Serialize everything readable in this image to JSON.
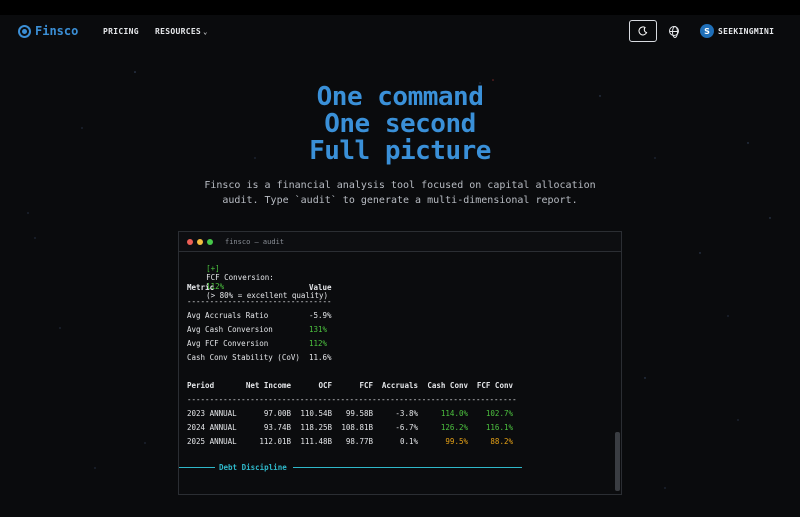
{
  "nav": {
    "brand": "Finsco",
    "links": [
      "PRICING",
      "RESOURCES"
    ],
    "user_initial": "S",
    "username": "SEEKINGMINI"
  },
  "hero": {
    "lines": [
      "One command",
      "One second",
      "Full picture"
    ],
    "subtitle_lines": [
      "Finsco is a financial analysis tool focused on capital allocation",
      "audit. Type `audit` to generate a multi-dimensional report."
    ]
  },
  "terminal": {
    "title": "finsco — audit",
    "fcf_line": {
      "prefix": "[+]",
      "label": "FCF Conversion:",
      "value": "112%",
      "note": "(> 80% = excellent quality)"
    },
    "summary_headers": [
      "Metric",
      "Value"
    ],
    "summary_rule": "--------------------------------",
    "summary_rows": [
      {
        "metric": "Avg Accruals Ratio",
        "value": "-5.9%",
        "tone": "normal"
      },
      {
        "metric": "Avg Cash Conversion",
        "value": "131%",
        "tone": "green"
      },
      {
        "metric": "Avg FCF Conversion",
        "value": "112%",
        "tone": "green"
      },
      {
        "metric": "Cash Conv Stability (CoV)",
        "value": "11.6%",
        "tone": "normal"
      }
    ],
    "period_headers": [
      "Period",
      "Net Income",
      "OCF",
      "FCF",
      "Accruals",
      "Cash Conv",
      "FCF Conv"
    ],
    "period_rule": "-------------------------------------------------------------------------",
    "period_rows": [
      {
        "period": "2023 ANNUAL",
        "net_income": "97.00B",
        "ocf": "110.54B",
        "fcf": "99.58B",
        "accruals": "-3.8%",
        "cash_conv": "114.0%",
        "fcf_conv": "102.7%",
        "cash_tone": "green",
        "fcf_tone": "green"
      },
      {
        "period": "2024 ANNUAL",
        "net_income": "93.74B",
        "ocf": "118.25B",
        "fcf": "108.81B",
        "accruals": "-6.7%",
        "cash_conv": "126.2%",
        "fcf_conv": "116.1%",
        "cash_tone": "green",
        "fcf_tone": "green"
      },
      {
        "period": "2025 ANNUAL",
        "net_income": "112.01B",
        "ocf": "111.48B",
        "fcf": "98.77B",
        "accruals": "0.1%",
        "cash_conv": "99.5%",
        "fcf_conv": "88.2%",
        "cash_tone": "orange",
        "fcf_tone": "orange"
      }
    ],
    "section_title": "Debt Discipline"
  },
  "colors": {
    "accent": "#3a90d8",
    "good": "#4cc23f",
    "warn": "#e5a116",
    "section": "#2fb8c9"
  },
  "icons": [
    "logo-icon",
    "chevron-down-icon",
    "moon-icon",
    "globe-icon"
  ]
}
